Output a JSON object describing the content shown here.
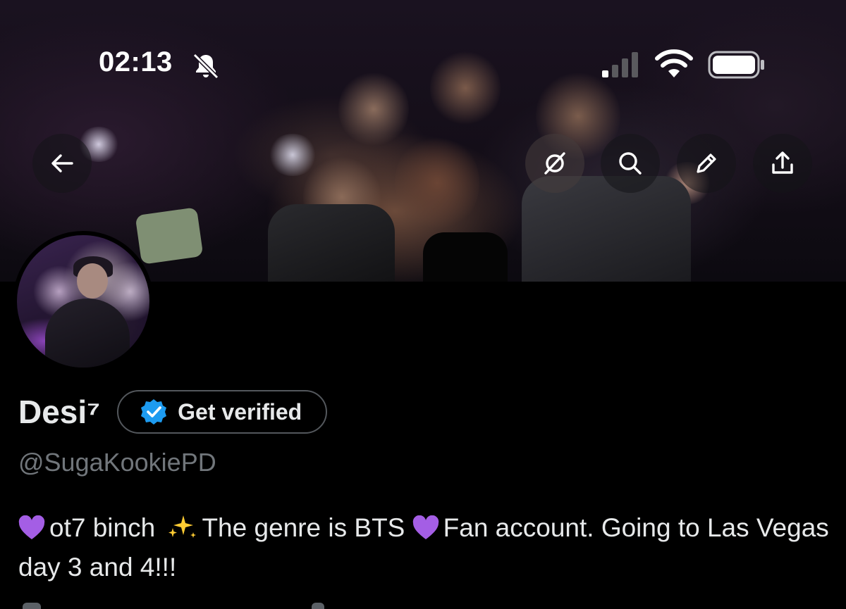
{
  "status_bar": {
    "time": "02:13",
    "icons": [
      "bell-muted-icon",
      "signal-icon",
      "wifi-icon",
      "battery-icon"
    ]
  },
  "header_actions": {
    "icons": [
      "back-arrow-icon",
      "grok-icon",
      "search-icon",
      "pencil-icon",
      "share-icon"
    ]
  },
  "profile": {
    "display_name": "Desi⁷",
    "verify_button_label": "Get verified",
    "handle": "@SugaKookiePD",
    "bio": {
      "part1": "ot7 binch",
      "part2": "The genre is BTS",
      "part3": "Fan account. Going to Las Vegas day 3 and 4!!!"
    }
  },
  "colors": {
    "background": "#000000",
    "text_primary": "#e7e9ea",
    "text_secondary": "#71767b",
    "verified_blue": "#1d9bf0",
    "heart_purple": "#a45ee5",
    "sparkle_yellow": "#ffcc33"
  }
}
